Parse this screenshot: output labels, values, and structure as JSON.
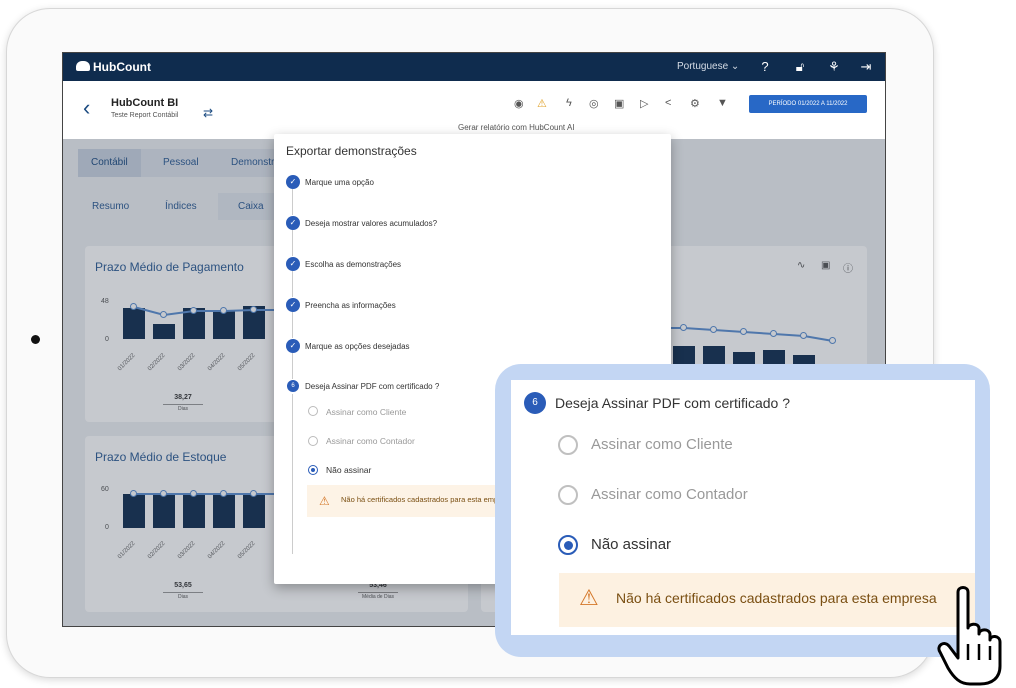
{
  "app": {
    "logo": "HubCount",
    "language": "Portuguese ⌄",
    "icons": [
      "help-icon",
      "lock-icon",
      "lightbulb-icon",
      "logout-icon"
    ]
  },
  "header": {
    "title": "HubCount BI",
    "subtitle": "Teste Report Contábil",
    "gerar": "Gerar relatório com HubCount AI",
    "periodo": "PERÍODO 01/2022 A 11/2022"
  },
  "tabs": [
    "Contábil",
    "Pessoal",
    "Demonstr"
  ],
  "subtabs": [
    "Resumo",
    "Índices",
    "Caixa"
  ],
  "card1": {
    "title": "Prazo Médio de Pagamento",
    "y_top": "48",
    "y_zero": "0",
    "stat_value": "38,27",
    "stat_unit": "Dias",
    "categories": [
      "01/2022",
      "02/2022",
      "03/2022",
      "04/2022",
      "05/2022"
    ]
  },
  "card2": {
    "title": "Prazo Médio de Estoque",
    "y_top": "60",
    "y_zero": "0",
    "stat_value": "53,65",
    "stat_unit": "Dias",
    "stat2_value": "53,46",
    "stat2_unit": "Média de Dias",
    "categories": [
      "01/2022",
      "02/2022",
      "03/2022",
      "04/2022",
      "05/2022"
    ]
  },
  "modal": {
    "title": "Exportar demonstrações",
    "steps": [
      "Marque uma opção",
      "Deseja mostrar valores acumulados?",
      "Escolha as demonstrações",
      "Preencha as informações",
      "Marque as opções desejadas",
      "Deseja Assinar PDF com certificado ?"
    ],
    "step6_number": "6",
    "options": [
      "Assinar como Cliente",
      "Assinar como Contador",
      "Não assinar"
    ],
    "selected": "Não assinar",
    "warning": "Não há certificados cadastrados para esta empresa"
  }
}
